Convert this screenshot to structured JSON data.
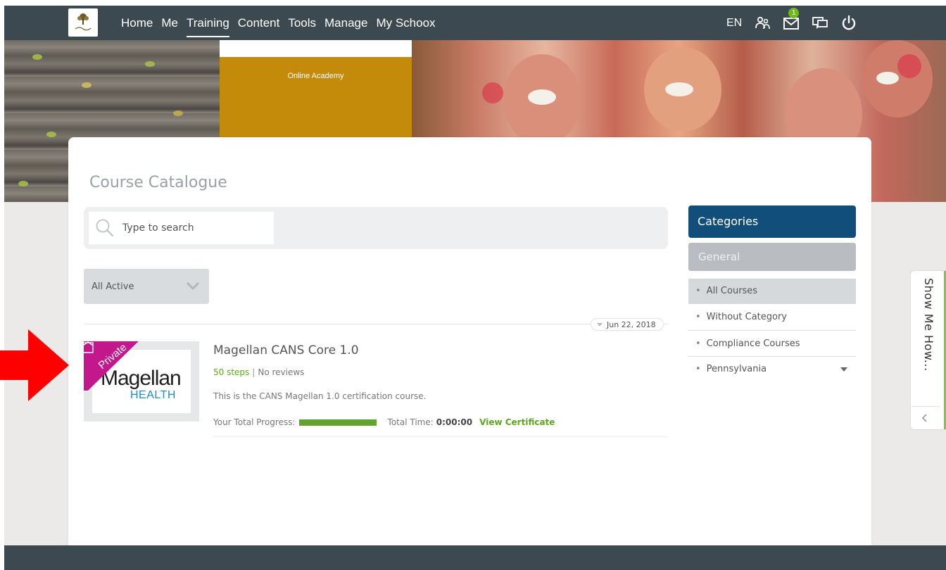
{
  "nav": {
    "items": [
      "Home",
      "Me",
      "Training",
      "Content",
      "Tools",
      "Manage",
      "My Schoox"
    ],
    "active": "Training",
    "language": "EN",
    "notification_count": "1"
  },
  "banner": {
    "tile_label": "Online Academy"
  },
  "page": {
    "title": "Course Catalogue"
  },
  "search": {
    "placeholder": "Type to search"
  },
  "filter": {
    "selected": "All Active"
  },
  "course": {
    "date": "Jun 22, 2018",
    "title": "Magellan CANS Core 1.0",
    "steps": "50 steps",
    "reviews": "No reviews",
    "description": "This is the CANS Magellan 1.0 certification course.",
    "progress_label": "Your Total Progress:",
    "progress_fraction": 1.0,
    "time_label": "Total Time:",
    "time_value": "0:00:00",
    "certificate_label": "View Certificate",
    "ribbon_label": "Private",
    "logo_word": "Magellan",
    "logo_health": "HEALTH"
  },
  "categories": {
    "header": "Categories",
    "group": "General",
    "items": [
      "All Courses",
      "Without Category",
      "Compliance Courses",
      "Pennsylvania"
    ],
    "selected": "All Courses"
  },
  "help_tab": {
    "label": "Show Me How..."
  },
  "colors": {
    "topbar": "#3d4950",
    "accent_blue": "#114e7a",
    "accent_green": "#5ea81c",
    "gold_tile": "#c48b0a",
    "arrow_red": "#ff0000"
  }
}
